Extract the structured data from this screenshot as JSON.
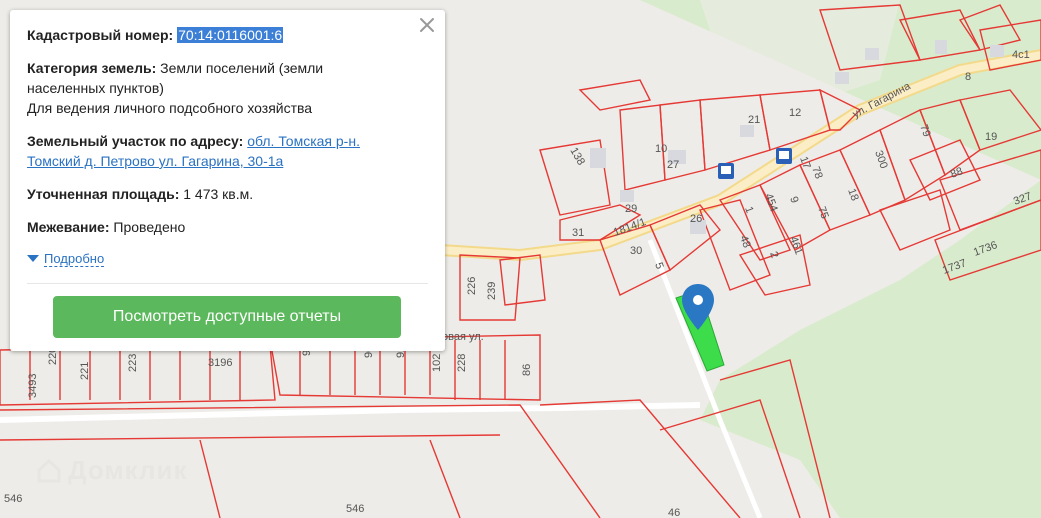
{
  "panel": {
    "cadastral_label": "Кадастровый номер:",
    "cadastral_value": "70:14:0116001:6",
    "category_label": "Категория земель:",
    "category_value_1": "Земли поселений (земли",
    "category_value_2": "населенных пунктов)",
    "category_value_3": "Для ведения личного подсобного хозяйства",
    "address_label": "Земельный участок по адресу:",
    "address_value_1": "обл. Томская р-н.",
    "address_value_2": "Томский д. Петрово ул. Гагарина, 30-1а",
    "area_label": "Уточненная площадь:",
    "area_value": "1 473 кв.м.",
    "survey_label": "Межевание:",
    "survey_value": "Проведено",
    "more_link": "Подробно",
    "reports_button": "Посмотреть доступные отчеты"
  },
  "map": {
    "street_label": "ул. Гагарина",
    "street_label_2": "овая ул.",
    "watermark": "Домклик",
    "parcel_labels": [
      "4с1",
      "8",
      "12",
      "21",
      "10",
      "27",
      "26",
      "29",
      "31",
      "30",
      "5",
      "1",
      "454",
      "48",
      "2",
      "461",
      "9",
      "75",
      "78",
      "17",
      "18",
      "300",
      "79",
      "19",
      "88",
      "327",
      "1736",
      "1737",
      "138",
      "1814/1",
      "226",
      "239",
      "3196",
      "99",
      "96",
      "92",
      "102",
      "228",
      "86",
      "223",
      "221",
      "220",
      "3493",
      "546",
      "546",
      "46"
    ],
    "colors": {
      "parcel_line": "#e53935",
      "selected_parcel": "#3ddc4a",
      "pin": "#2a78c4",
      "forest": "#d9ebcd",
      "road": "#fbeec7"
    }
  }
}
